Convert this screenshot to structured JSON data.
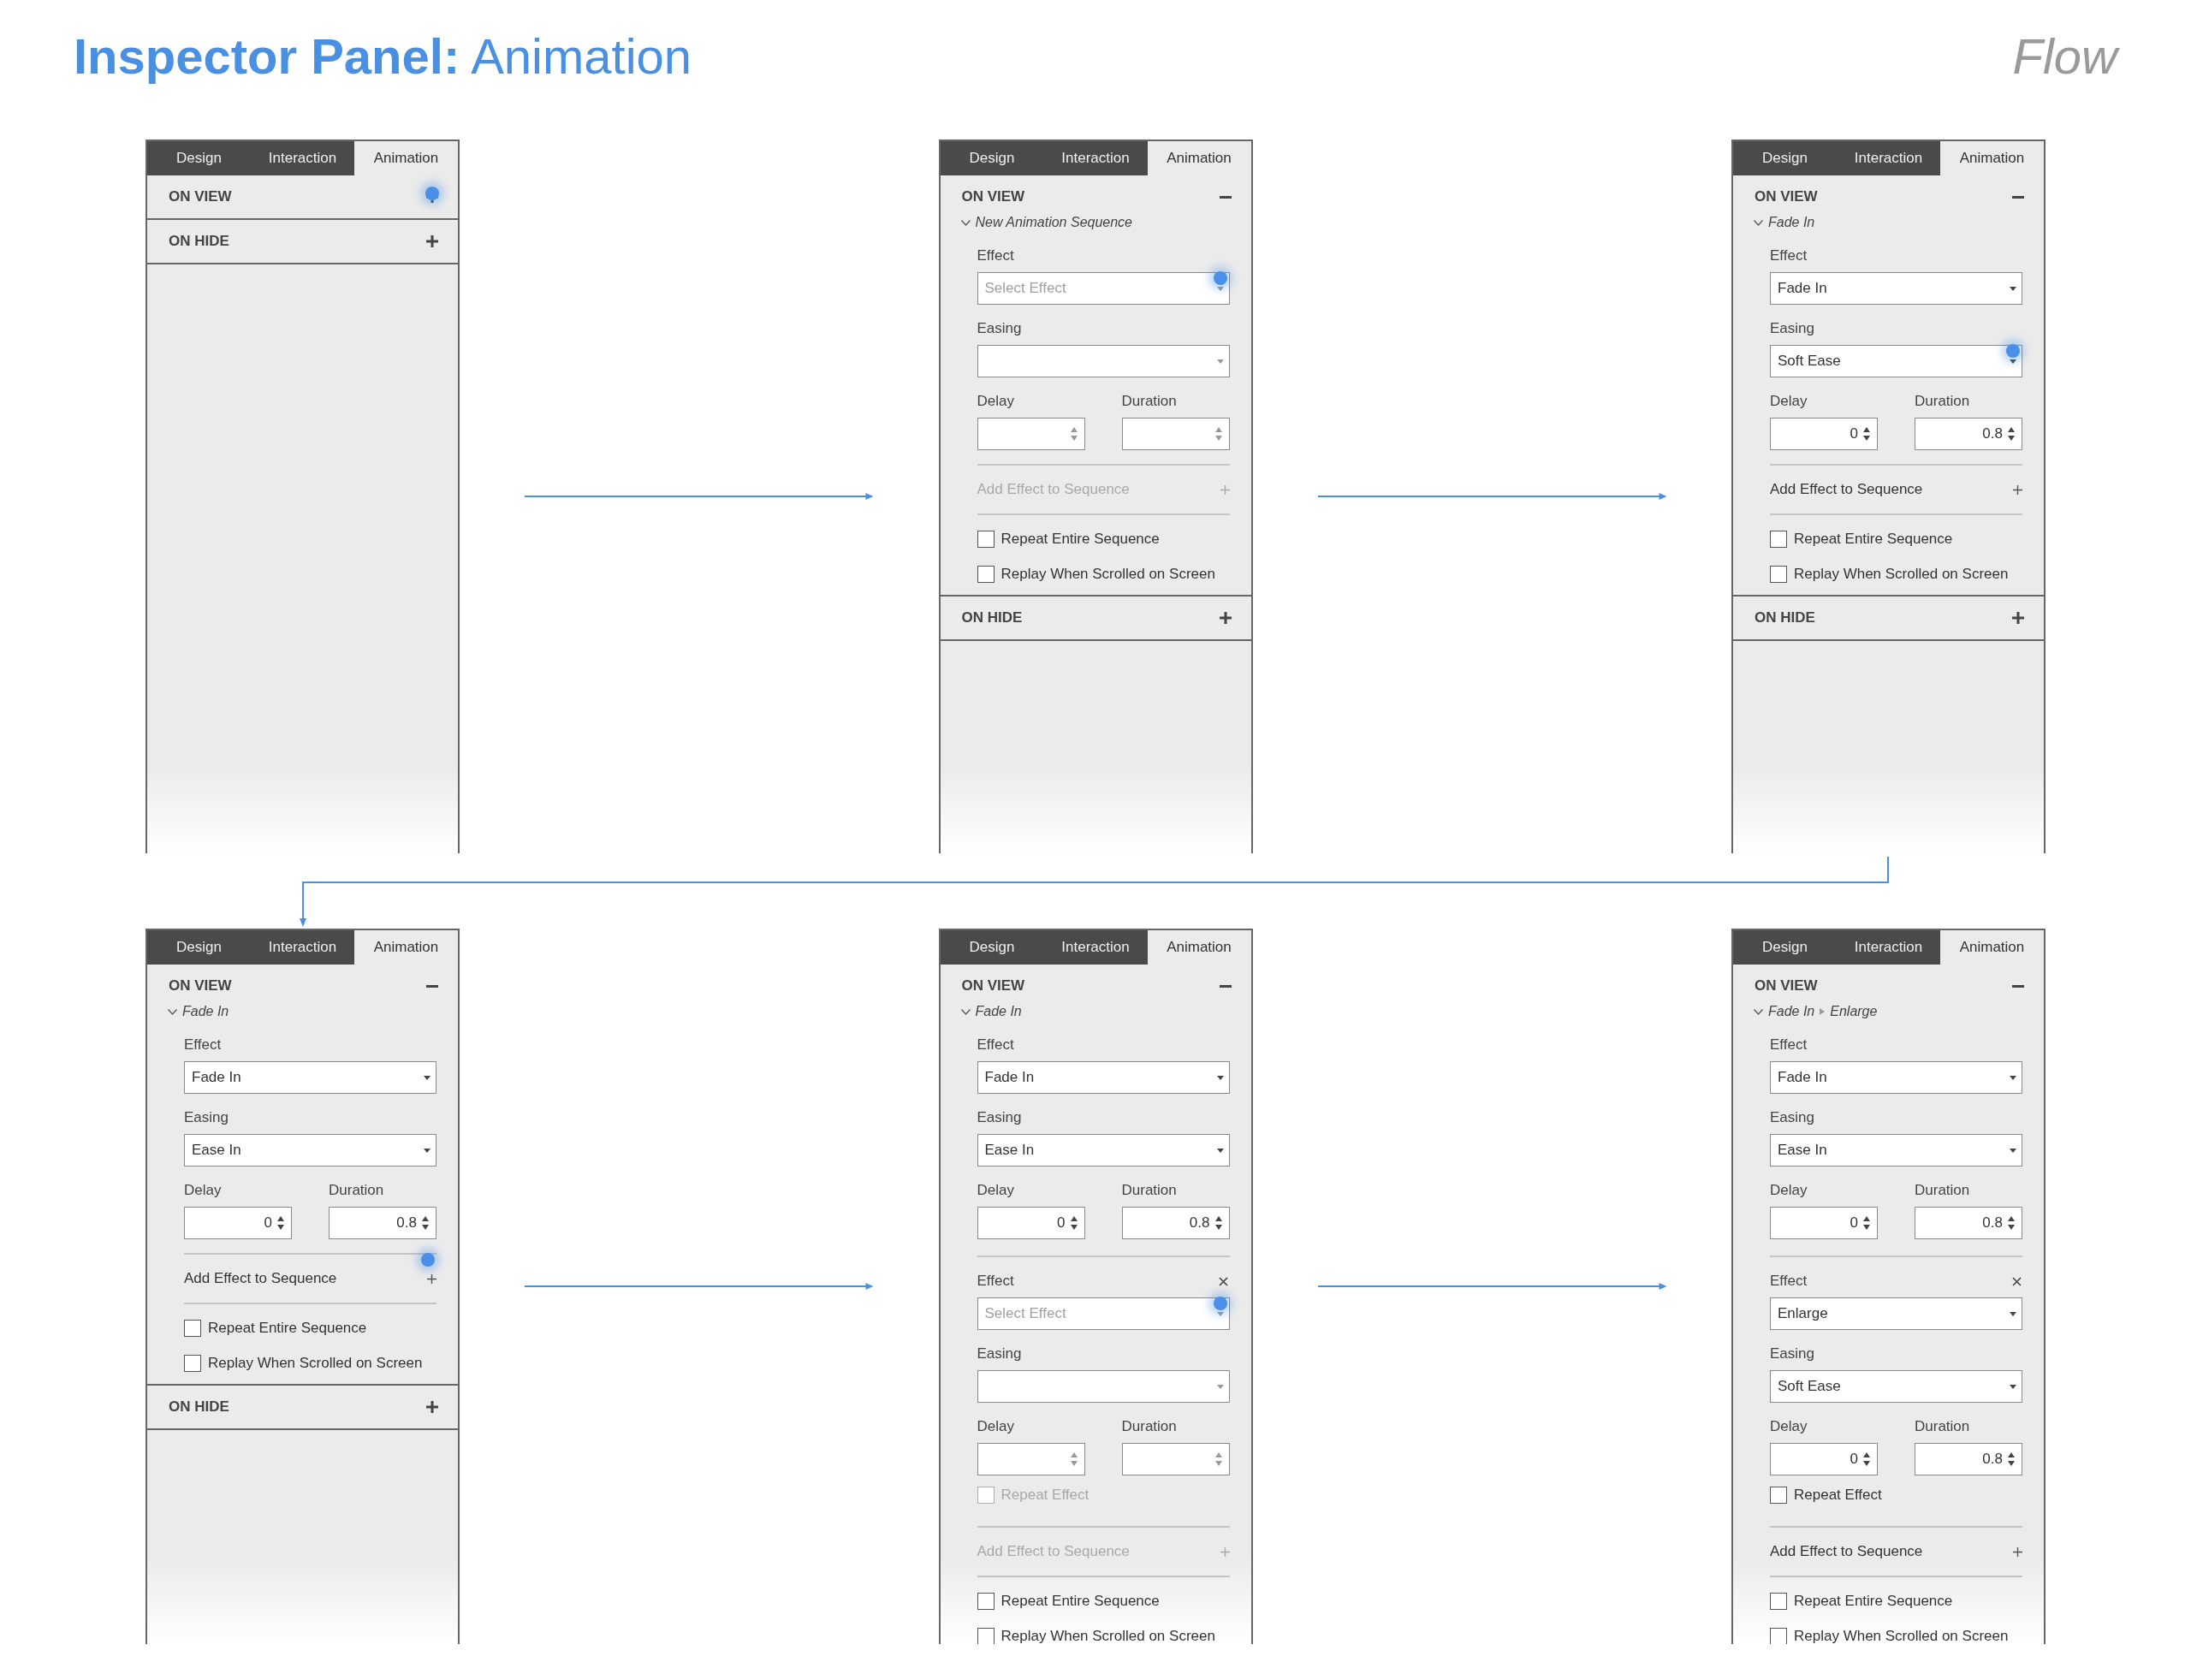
{
  "header": {
    "title": "**Inspector Panel:** Animation",
    "flow_label": "Flow"
  },
  "panels": [
    {
      "tabs": [
        {
          "label": "Design",
          "selected": false
        },
        {
          "label": "Interaction",
          "selected": false
        },
        {
          "label": "Animation",
          "selected": true
        }
      ],
      "sections": [
        {
          "title": "ON VIEW",
          "expanded": false,
          "tapped": true
        },
        {
          "title": "ON HIDE",
          "expanded": false
        }
      ]
    },
    {
      "tabs": [
        {
          "label": "Design",
          "selected": false
        },
        {
          "label": "Interaction",
          "selected": false
        },
        {
          "label": "Animation",
          "selected": true
        }
      ],
      "sections": [
        {
          "title": "ON VIEW",
          "expanded": true,
          "sequence": {
            "steps": [
              "New Animation Sequence"
            ]
          },
          "effects": [
            {
              "effect": {
                "label": "Effect",
                "placeholder": "Select Effect",
                "tapped": true
              },
              "easing": {
                "label": "Easing"
              },
              "delay": {
                "label": "Delay"
              },
              "duration": {
                "label": "Duration"
              }
            }
          ],
          "add": {
            "label": "Add Effect to Sequence",
            "disabled": true
          },
          "options": [
            {
              "label": "Repeat Entire Sequence",
              "checked": false,
              "disabled": false
            },
            {
              "label": "Replay When Scrolled on Screen",
              "checked": false,
              "disabled": false
            }
          ]
        },
        {
          "title": "ON HIDE",
          "expanded": false
        }
      ]
    },
    {
      "tabs": [
        {
          "label": "Design",
          "selected": false
        },
        {
          "label": "Interaction",
          "selected": false
        },
        {
          "label": "Animation",
          "selected": true
        }
      ],
      "sections": [
        {
          "title": "ON VIEW",
          "expanded": true,
          "sequence": {
            "steps": [
              "Fade In"
            ]
          },
          "effects": [
            {
              "effect": {
                "label": "Effect",
                "value": "Fade In"
              },
              "easing": {
                "label": "Easing",
                "value": "Soft Ease",
                "tapped": true
              },
              "delay": {
                "label": "Delay",
                "value": "0"
              },
              "duration": {
                "label": "Duration",
                "value": "0.8"
              }
            }
          ],
          "add": {
            "label": "Add Effect to Sequence",
            "disabled": false
          },
          "options": [
            {
              "label": "Repeat Entire Sequence",
              "checked": false,
              "disabled": false
            },
            {
              "label": "Replay When Scrolled on Screen",
              "checked": false,
              "disabled": false
            }
          ]
        },
        {
          "title": "ON HIDE",
          "expanded": false
        }
      ]
    },
    {
      "tabs": [
        {
          "label": "Design",
          "selected": false
        },
        {
          "label": "Interaction",
          "selected": false
        },
        {
          "label": "Animation",
          "selected": true
        }
      ],
      "sections": [
        {
          "title": "ON VIEW",
          "expanded": true,
          "sequence": {
            "steps": [
              "Fade In"
            ]
          },
          "effects": [
            {
              "effect": {
                "label": "Effect",
                "value": "Fade In"
              },
              "easing": {
                "label": "Easing",
                "value": "Ease In"
              },
              "delay": {
                "label": "Delay",
                "value": "0"
              },
              "duration": {
                "label": "Duration",
                "value": "0.8"
              }
            }
          ],
          "add": {
            "label": "Add Effect to Sequence",
            "disabled": false,
            "tapped": true
          },
          "options": [
            {
              "label": "Repeat Entire Sequence",
              "checked": false,
              "disabled": false
            },
            {
              "label": "Replay When Scrolled on Screen",
              "checked": false,
              "disabled": false
            }
          ]
        },
        {
          "title": "ON HIDE",
          "expanded": false
        }
      ]
    },
    {
      "tabs": [
        {
          "label": "Design",
          "selected": false
        },
        {
          "label": "Interaction",
          "selected": false
        },
        {
          "label": "Animation",
          "selected": true
        }
      ],
      "sections": [
        {
          "title": "ON VIEW",
          "expanded": true,
          "sequence": {
            "steps": [
              "Fade In"
            ]
          },
          "effects": [
            {
              "effect": {
                "label": "Effect",
                "value": "Fade In"
              },
              "easing": {
                "label": "Easing",
                "value": "Ease In"
              },
              "delay": {
                "label": "Delay",
                "value": "0"
              },
              "duration": {
                "label": "Duration",
                "value": "0.8"
              }
            },
            {
              "removable": true,
              "effect": {
                "label": "Effect",
                "placeholder": "Select Effect",
                "tapped": true
              },
              "easing": {
                "label": "Easing"
              },
              "delay": {
                "label": "Delay"
              },
              "duration": {
                "label": "Duration"
              },
              "repeat": {
                "label": "Repeat Effect",
                "checked": false,
                "disabled": true
              }
            }
          ],
          "add": {
            "label": "Add Effect to Sequence",
            "disabled": true
          },
          "options": [
            {
              "label": "Repeat Entire Sequence",
              "checked": false,
              "disabled": false
            },
            {
              "label": "Replay When Scrolled on Screen",
              "checked": false,
              "disabled": false
            }
          ]
        }
      ]
    },
    {
      "tabs": [
        {
          "label": "Design",
          "selected": false
        },
        {
          "label": "Interaction",
          "selected": false
        },
        {
          "label": "Animation",
          "selected": true
        }
      ],
      "sections": [
        {
          "title": "ON VIEW",
          "expanded": true,
          "sequence": {
            "steps": [
              "Fade In",
              "Enlarge"
            ]
          },
          "effects": [
            {
              "effect": {
                "label": "Effect",
                "value": "Fade In"
              },
              "easing": {
                "label": "Easing",
                "value": "Ease In"
              },
              "delay": {
                "label": "Delay",
                "value": "0"
              },
              "duration": {
                "label": "Duration",
                "value": "0.8"
              }
            },
            {
              "removable": true,
              "effect": {
                "label": "Effect",
                "value": "Enlarge"
              },
              "easing": {
                "label": "Easing",
                "value": "Soft Ease"
              },
              "delay": {
                "label": "Delay",
                "value": "0"
              },
              "duration": {
                "label": "Duration",
                "value": "0.8"
              },
              "repeat": {
                "label": "Repeat Effect",
                "checked": false,
                "disabled": false
              }
            }
          ],
          "add": {
            "label": "Add Effect to Sequence",
            "disabled": false
          },
          "options": [
            {
              "label": "Repeat Entire Sequence",
              "checked": false,
              "disabled": false
            },
            {
              "label": "Replay When Scrolled on Screen",
              "checked": false,
              "disabled": false
            }
          ]
        }
      ]
    }
  ]
}
